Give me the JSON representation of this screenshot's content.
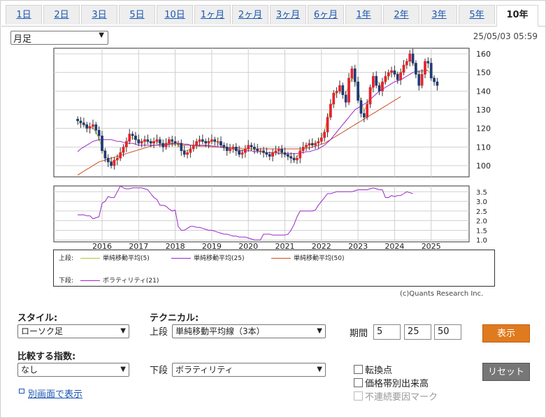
{
  "tabs": [
    "1日",
    "2日",
    "3日",
    "5日",
    "10日",
    "1ヶ月",
    "2ヶ月",
    "3ヶ月",
    "6ヶ月",
    "1年",
    "2年",
    "3年",
    "5年",
    "10年"
  ],
  "active_tab": "10年",
  "period_select": "月足",
  "timestamp": "25/05/03 05:59",
  "copyright": "(c)Quants Research Inc.",
  "colors": {
    "candle_up": "#e8222e",
    "candle_down": "#1f3a78",
    "sma5": "#b8c23a",
    "sma25": "#9b28c8",
    "sma50": "#cc4a1c",
    "volatility": "#9b28c8"
  },
  "legend": {
    "upper_label": "上段:",
    "lower_label": "下段:",
    "sma5": "単純移動平均(5)",
    "sma25": "単純移動平均(25)",
    "sma50": "単純移動平均(50)",
    "volatility": "ボラティリティ(21)"
  },
  "chart_data": [
    {
      "type": "candlestick",
      "x_ticks": [
        "2016",
        "2017",
        "2018",
        "2019",
        "2020",
        "2021",
        "2022",
        "2023",
        "2024",
        "2025"
      ],
      "y_ticks": [
        100,
        110,
        120,
        130,
        140,
        150,
        160
      ],
      "ylim": [
        94,
        163
      ],
      "grid": true,
      "start": "2015-05",
      "close": [
        124,
        123,
        122,
        120,
        121,
        122,
        119,
        116,
        108,
        104,
        102,
        100,
        103,
        104,
        107,
        110,
        113,
        117,
        116,
        114,
        112,
        113,
        114,
        113,
        112,
        113,
        114,
        112,
        110,
        112,
        114,
        113,
        112,
        112,
        108,
        106,
        107,
        109,
        111,
        113,
        114,
        113,
        112,
        113,
        114,
        113,
        113,
        111,
        110,
        108,
        109,
        110,
        108,
        106,
        107,
        109,
        111,
        110,
        109,
        108,
        108,
        107,
        106,
        105,
        107,
        108,
        109,
        107,
        106,
        105,
        104,
        103,
        104,
        108,
        110,
        111,
        112,
        111,
        112,
        113,
        115,
        118,
        126,
        133,
        139,
        140,
        143,
        138,
        134,
        147,
        152,
        145,
        135,
        128,
        126,
        133,
        142,
        148,
        143,
        140,
        145,
        148,
        150,
        151,
        149,
        146,
        150,
        154,
        156,
        160,
        155,
        149,
        143,
        149,
        156,
        155,
        147,
        145,
        143
      ],
      "ohlc_note": "monthly candles; open approximated from previous close",
      "sma5": [
        123,
        122.5,
        122,
        121,
        121,
        120,
        118,
        114,
        110,
        106,
        103,
        102,
        102.5,
        103.5,
        106,
        109,
        112,
        115,
        115,
        114,
        113,
        113,
        113,
        113,
        112.5,
        113,
        113,
        112,
        111,
        112,
        112.5,
        112.5,
        112,
        111,
        109,
        108,
        108,
        109,
        110.5,
        112,
        113,
        113,
        113,
        113,
        113,
        113,
        112.5,
        111,
        110,
        109,
        109,
        109,
        108,
        107.5,
        108,
        109,
        109.5,
        109,
        108.5,
        108,
        107.5,
        107,
        106.5,
        106,
        106.5,
        107,
        107.5,
        107,
        106,
        105,
        104,
        104,
        105,
        107,
        109,
        110.5,
        111,
        111.5,
        112,
        113,
        115,
        119,
        125,
        130,
        136,
        140,
        140,
        139,
        139,
        143,
        147,
        146,
        141,
        134,
        130,
        132,
        138,
        144,
        146,
        144,
        143,
        145,
        148,
        150,
        150,
        149,
        149,
        152,
        155,
        157,
        156,
        152,
        150,
        150,
        152,
        151,
        149,
        146
      ],
      "sma25": [
        107.5,
        109,
        110,
        111,
        112,
        113,
        113.5,
        114,
        114,
        114,
        114,
        114,
        113.5,
        113,
        113,
        112.5,
        112,
        112,
        112,
        111.5,
        111,
        111,
        111,
        111,
        111,
        111,
        111,
        111,
        111,
        111,
        111.5,
        112,
        112,
        112,
        112,
        111.5,
        111.5,
        111,
        111,
        111,
        111,
        111,
        111,
        111,
        110.5,
        110.5,
        110,
        110,
        109.5,
        109.5,
        109,
        109,
        108.5,
        108.5,
        108,
        108,
        108,
        108,
        107.5,
        107.5,
        107.5,
        107,
        107,
        107,
        107,
        107,
        106.5,
        106.5,
        106.5,
        106.5,
        106.5,
        106.5,
        106.5,
        107,
        107,
        107.5,
        107.5,
        108,
        108.5,
        109,
        110,
        111,
        112.5,
        114,
        116,
        118,
        120,
        122,
        124,
        126,
        128,
        130,
        131,
        132,
        133,
        134,
        135.5,
        137,
        138.5,
        140,
        141,
        142,
        143,
        144,
        145,
        145.5,
        146,
        147,
        148,
        149,
        150,
        150.5,
        150.5,
        151,
        151,
        151
      ],
      "sma50": [
        95,
        96,
        97,
        98,
        99,
        100,
        101,
        102,
        102.5,
        103,
        103.5,
        104,
        104.5,
        105,
        105.5,
        106,
        106.5,
        107,
        107.5,
        108,
        108.5,
        109,
        109.5,
        110,
        110.5,
        111,
        111,
        111.5,
        111.5,
        111.5,
        111.5,
        111.5,
        111.5,
        111.5,
        111,
        111,
        111,
        111,
        111,
        110.5,
        110.5,
        110.5,
        110.5,
        110.5,
        110,
        110,
        110,
        110,
        110,
        110,
        109.5,
        109.5,
        109.5,
        109.5,
        109,
        109,
        109,
        109,
        109,
        109,
        109,
        109,
        109,
        109,
        109,
        109,
        109,
        109,
        109,
        109,
        109,
        109,
        109,
        109,
        109,
        109.5,
        109.5,
        110,
        110.5,
        111,
        111.5,
        112,
        113,
        114,
        115,
        116,
        117,
        118,
        119,
        120,
        121,
        122,
        123,
        124,
        125,
        126,
        127,
        128,
        129,
        130,
        131,
        132,
        133,
        134,
        135,
        136,
        137
      ],
      "legend": [
        "単純移動平均(5)",
        "単純移動平均(25)",
        "単純移動平均(50)"
      ]
    },
    {
      "type": "line",
      "y_ticks": [
        1.0,
        1.5,
        2.0,
        2.5,
        3.0,
        3.5
      ],
      "ylim": [
        0.9,
        3.8
      ],
      "start": "2015-05",
      "series": [
        {
          "name": "ボラティリティ(21)",
          "values": [
            2.3,
            2.3,
            2.3,
            2.25,
            2.25,
            2.1,
            2.15,
            2.2,
            2.9,
            3.0,
            3.25,
            3.2,
            3.2,
            3.5,
            3.8,
            3.7,
            3.65,
            3.65,
            3.7,
            3.7,
            3.7,
            3.7,
            3.65,
            3.6,
            3.4,
            3.2,
            3.1,
            2.8,
            2.8,
            2.75,
            2.6,
            2.5,
            2.55,
            1.7,
            1.5,
            1.5,
            1.6,
            1.7,
            1.7,
            1.65,
            1.65,
            1.6,
            1.55,
            1.5,
            1.5,
            1.45,
            1.4,
            1.35,
            1.3,
            1.3,
            1.25,
            1.2,
            1.2,
            1.15,
            1.15,
            1.15,
            1.1,
            1.05,
            1.0,
            1.0,
            1.0,
            1.3,
            1.3,
            1.3,
            1.25,
            1.25,
            1.25,
            1.25,
            1.25,
            1.3,
            1.5,
            1.8,
            2.2,
            2.5,
            2.5,
            2.5,
            2.5,
            2.5,
            2.55,
            2.8,
            3.0,
            3.2,
            3.4,
            3.4,
            3.45,
            3.5,
            3.5,
            3.5,
            3.5,
            3.5,
            3.5,
            3.55,
            3.6,
            3.6,
            3.6,
            3.6,
            3.65,
            3.7,
            3.65,
            3.6,
            3.6,
            3.2,
            3.2,
            3.3,
            3.25,
            3.3,
            3.3,
            3.4,
            3.5,
            3.45,
            3.4
          ]
        }
      ]
    }
  ],
  "form": {
    "style_label": "スタイル:",
    "style_value": "ローソク足",
    "technical_label": "テクニカル:",
    "upper_label": "上段",
    "upper_value": "単純移動平均線（3本）",
    "period_label": "期間",
    "periods": [
      "5",
      "25",
      "50"
    ],
    "compare_label": "比較する指数:",
    "compare_value": "なし",
    "lower_label": "下段",
    "lower_value": "ボラティリティ",
    "display_button": "表示",
    "reset_button": "リセット",
    "checkbox_turning": "転換点",
    "checkbox_volume": "価格帯別出来高",
    "checkbox_gap": "不連続要因マーク",
    "open_window_link": "別画面で表示"
  }
}
